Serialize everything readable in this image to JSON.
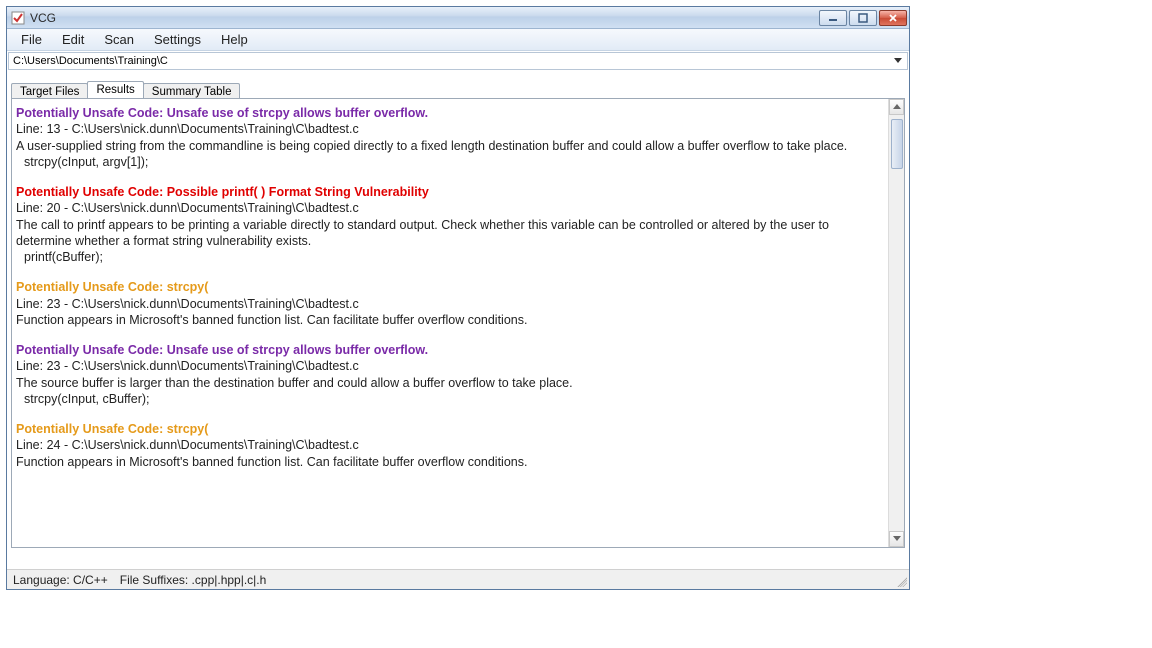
{
  "window": {
    "title": "VCG"
  },
  "menu": {
    "file": "File",
    "edit": "Edit",
    "scan": "Scan",
    "settings": "Settings",
    "help": "Help"
  },
  "path": "C:\\Users\\Documents\\Training\\C",
  "tabs": {
    "target_files": "Target Files",
    "results": "Results",
    "summary_table": "Summary Table"
  },
  "findings": [
    {
      "severity": "purple",
      "title": "Potentially Unsafe Code: Unsafe use of strcpy allows buffer overflow.",
      "location": "Line: 13 - C:\\Users\\nick.dunn\\Documents\\Training\\C\\badtest.c",
      "description": "A user-supplied string from the commandline is being copied directly to a fixed length destination buffer and could allow a buffer overflow to take place.",
      "snippet": "strcpy(cInput, argv[1]);"
    },
    {
      "severity": "red",
      "title": "Potentially Unsafe Code: Possible printf( ) Format String Vulnerability",
      "location": "Line: 20 - C:\\Users\\nick.dunn\\Documents\\Training\\C\\badtest.c",
      "description": "The call to printf appears to be printing a variable directly to standard output. Check whether this variable can be controlled or altered by the user to determine whether a format string vulnerability exists.",
      "snippet": "printf(cBuffer);"
    },
    {
      "severity": "orange",
      "title": "Potentially Unsafe Code: strcpy(",
      "location": "Line: 23 - C:\\Users\\nick.dunn\\Documents\\Training\\C\\badtest.c",
      "description": "Function appears in Microsoft's banned function list. Can facilitate buffer overflow conditions.",
      "snippet": ""
    },
    {
      "severity": "purple",
      "title": "Potentially Unsafe Code: Unsafe use of strcpy allows buffer overflow.",
      "location": "Line: 23 - C:\\Users\\nick.dunn\\Documents\\Training\\C\\badtest.c",
      "description": "The source buffer is larger than the destination buffer and could allow a buffer overflow to take place.",
      "snippet": "strcpy(cInput, cBuffer);"
    },
    {
      "severity": "orange",
      "title": "Potentially Unsafe Code: strcpy(",
      "location": "Line: 24 - C:\\Users\\nick.dunn\\Documents\\Training\\C\\badtest.c",
      "description": "Function appears in Microsoft's banned function list. Can facilitate buffer overflow conditions.",
      "snippet": ""
    }
  ],
  "status": {
    "language": "Language: C/C++",
    "suffixes": "File Suffixes: .cpp|.hpp|.c|.h"
  }
}
